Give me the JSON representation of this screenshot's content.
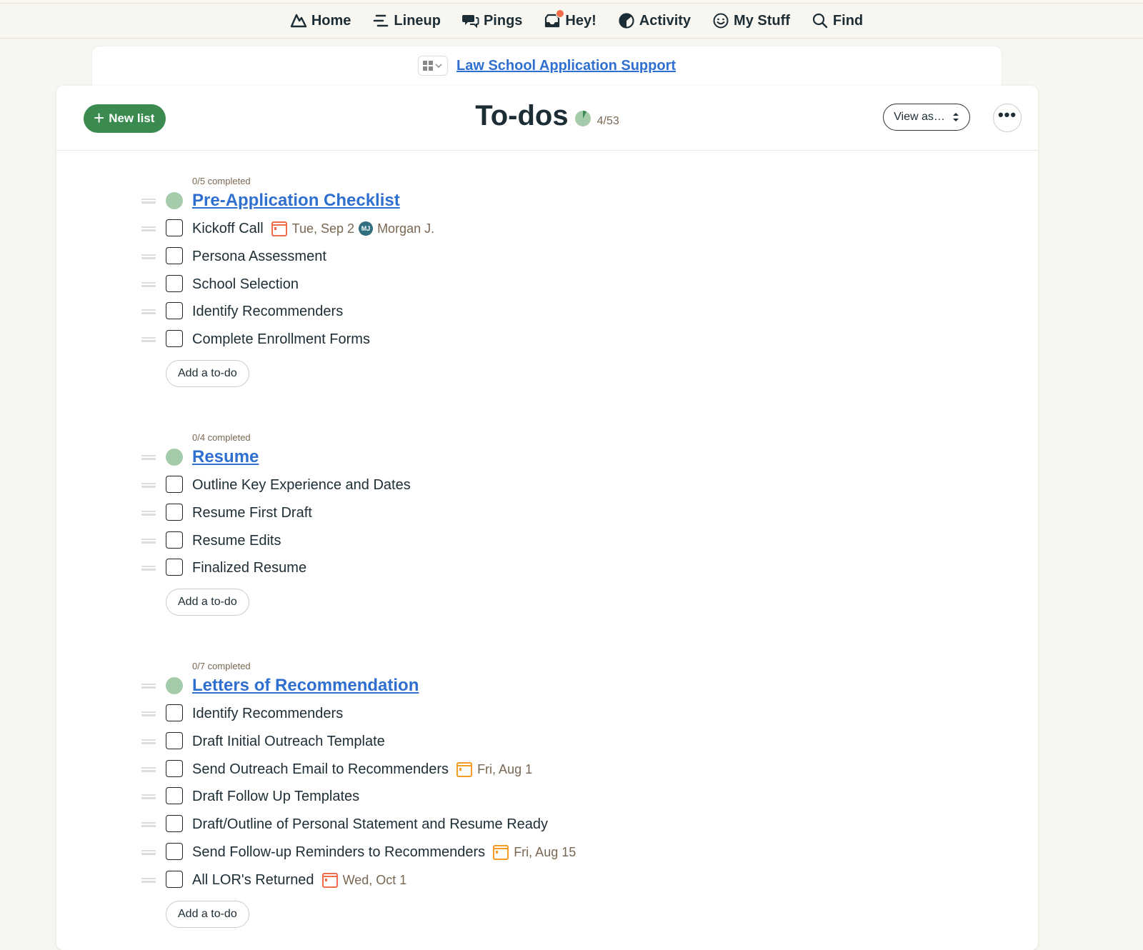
{
  "nav": {
    "items": [
      {
        "label": "Home",
        "icon": "basecamp-home-icon"
      },
      {
        "label": "Lineup",
        "icon": "lineup-icon"
      },
      {
        "label": "Pings",
        "icon": "pings-chat-icon"
      },
      {
        "label": "Hey!",
        "icon": "hey-inbox-icon"
      },
      {
        "label": "Activity",
        "icon": "activity-icon"
      },
      {
        "label": "My Stuff",
        "icon": "smiley-icon"
      },
      {
        "label": "Find",
        "icon": "search-icon"
      }
    ]
  },
  "project": {
    "name": "Law School Application Support"
  },
  "header": {
    "new_list_label": "New list",
    "title": "To-dos",
    "count": "4/53",
    "view_as_label": "View as…",
    "more_label": "•••"
  },
  "colors": {
    "accent_green": "#3b8a4f",
    "link_blue": "#2f6fd0",
    "due_red": "#ef6b4a",
    "due_orange": "#f59a23",
    "list_dot": "#a6cbaa"
  },
  "lists": [
    {
      "completed": "0/5 completed",
      "title": "Pre-Application Checklist",
      "add_label": "Add a to-do",
      "todos": [
        {
          "text": "Kickoff Call",
          "due": "Tue, Sep 2",
          "due_color": "red",
          "assignee": "Morgan J.",
          "initials": "MJ"
        },
        {
          "text": "Persona Assessment"
        },
        {
          "text": "School Selection"
        },
        {
          "text": "Identify Recommenders"
        },
        {
          "text": "Complete Enrollment Forms"
        }
      ]
    },
    {
      "completed": "0/4 completed",
      "title": "Resume",
      "add_label": "Add a to-do",
      "todos": [
        {
          "text": "Outline Key Experience and Dates"
        },
        {
          "text": "Resume First Draft"
        },
        {
          "text": "Resume Edits"
        },
        {
          "text": "Finalized Resume"
        }
      ]
    },
    {
      "completed": "0/7 completed",
      "title": "Letters of Recommendation",
      "add_label": "Add a to-do",
      "todos": [
        {
          "text": "Identify Recommenders"
        },
        {
          "text": "Draft Initial Outreach Template"
        },
        {
          "text": "Send Outreach Email to Recommenders",
          "due": "Fri, Aug 1",
          "due_color": "orange"
        },
        {
          "text": "Draft Follow Up Templates"
        },
        {
          "text": "Draft/Outline of Personal Statement and Resume Ready"
        },
        {
          "text": "Send Follow-up Reminders to Recommenders",
          "due": "Fri, Aug 15",
          "due_color": "orange"
        },
        {
          "text": "All LOR's Returned",
          "due": "Wed, Oct 1",
          "due_color": "red"
        }
      ]
    }
  ]
}
